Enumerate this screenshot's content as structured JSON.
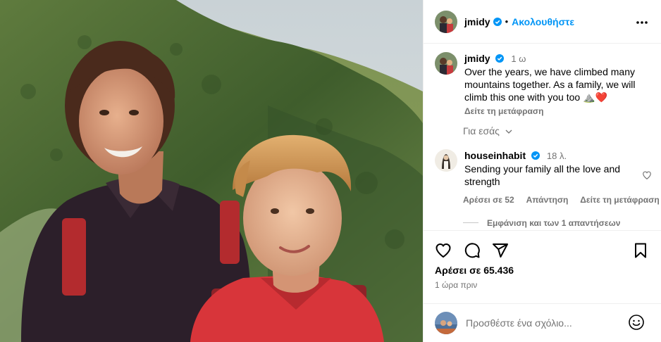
{
  "header": {
    "username": "jmidy",
    "separator": "•",
    "follow_label": "Ακολουθήστε",
    "verified_icon": "verified-badge-icon",
    "more_icon": "more-horizontal-icon"
  },
  "caption": {
    "username": "jmidy",
    "time": "1 ω",
    "text": "Over the years, we have climbed many mountains together. As a family, we will climb this one with you too ⛰️❤️",
    "text_plain": "Over the years, we have climbed many mountains together. As a family, we will climb this one with you too",
    "emoji_mountain": "⛰️",
    "emoji_heart": "❤️",
    "translate_label": "Δείτε τη μετάφραση"
  },
  "for_you": {
    "label": "Για εσάς"
  },
  "comment": {
    "username": "houseinhabit",
    "time": "18 λ.",
    "text": "Sending your family all the love and strength",
    "likes_label": "Αρέσει σε 52",
    "reply_label": "Απάντηση",
    "translate_label": "Δείτε τη μετάφραση",
    "view_replies_label": "Εμφάνιση και των 1 απαντήσεων"
  },
  "actions": {
    "likes_label": "Αρέσει σε 65.436",
    "time_label": "1 ώρα πριν",
    "icons": [
      "heart-icon",
      "comment-icon",
      "share-icon",
      "bookmark-icon"
    ]
  },
  "add_comment": {
    "placeholder": "Προσθέστε ένα σχόλιο...",
    "emoji_icon": "smiley-icon"
  },
  "colors": {
    "accent": "#0095f6",
    "secondary_text": "#737373",
    "divider": "#efefef",
    "heart_red": "#ed1c24"
  }
}
